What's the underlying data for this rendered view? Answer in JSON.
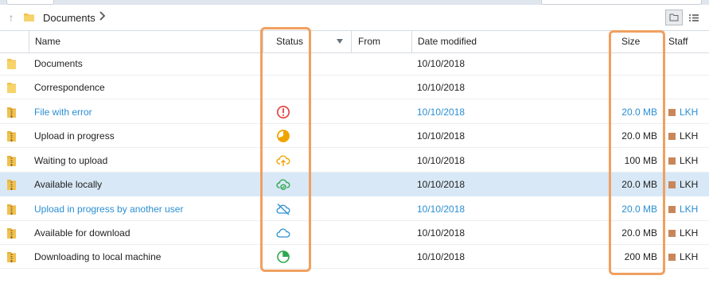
{
  "breadcrumb": {
    "folder": "Documents"
  },
  "columns": {
    "name": "Name",
    "status": "Status",
    "from": "From",
    "date": "Date modified",
    "size": "Size",
    "staff": "Staff"
  },
  "rows": [
    {
      "name": "Documents",
      "kind": "folder",
      "status": "",
      "date": "10/10/2018",
      "size": "",
      "staff": "",
      "link": false
    },
    {
      "name": "Correspondence",
      "kind": "folder",
      "status": "",
      "date": "10/10/2018",
      "size": "",
      "staff": "",
      "link": false
    },
    {
      "name": "File with error",
      "kind": "archive",
      "status": "error",
      "date": "10/10/2018",
      "size": "20.0 MB",
      "staff": "LKH",
      "link": true
    },
    {
      "name": "Upload in progress",
      "kind": "archive",
      "status": "upload-progress",
      "date": "10/10/2018",
      "size": "20.0 MB",
      "staff": "LKH",
      "link": false
    },
    {
      "name": "Waiting to upload",
      "kind": "archive",
      "status": "waiting-upload",
      "date": "10/10/2018",
      "size": "100 MB",
      "staff": "LKH",
      "link": false
    },
    {
      "name": "Available locally",
      "kind": "archive",
      "status": "available-locally",
      "date": "10/10/2018",
      "size": "20.0 MB",
      "staff": "LKH",
      "link": false,
      "selected": true
    },
    {
      "name": "Upload in progress by another user",
      "kind": "archive",
      "status": "upload-other-user",
      "date": "10/10/2018",
      "size": "20.0 MB",
      "staff": "LKH",
      "link": true
    },
    {
      "name": "Available for download",
      "kind": "archive",
      "status": "available-download",
      "date": "10/10/2018",
      "size": "20.0 MB",
      "staff": "LKH",
      "link": false
    },
    {
      "name": "Downloading to local machine",
      "kind": "archive",
      "status": "downloading",
      "date": "10/10/2018",
      "size": "200 MB",
      "staff": "LKH",
      "link": false
    }
  ],
  "colors": {
    "link": "#2a8fd4",
    "error": "#e23c3c",
    "progress": "#f0a400",
    "ok": "#2fa84f",
    "cloud": "#2a8fd4",
    "selected": "#d8e8f6",
    "highlight": "#f0a060",
    "staff_tag": "#c8875a"
  }
}
